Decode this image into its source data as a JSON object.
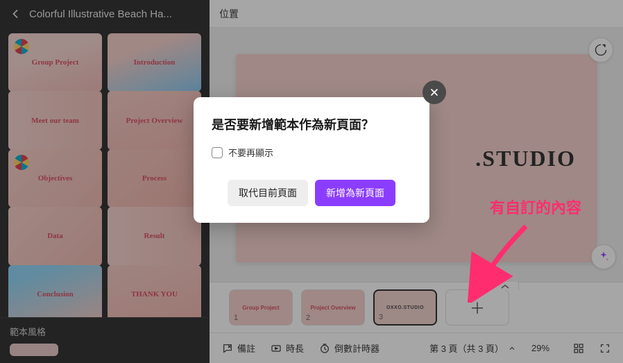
{
  "sidebar": {
    "title": "Colorful Illustrative Beach Ha...",
    "footer_label": "範本風格",
    "templates": [
      {
        "label": "Group Project",
        "cls": "thumb-group"
      },
      {
        "label": "Introduction",
        "cls": "thumb-intro"
      },
      {
        "label": "Meet our team",
        "cls": "thumb-team"
      },
      {
        "label": "Project Overview",
        "cls": "thumb-overview"
      },
      {
        "label": "Objectives",
        "cls": "thumb-obj"
      },
      {
        "label": "Process",
        "cls": "thumb-process"
      },
      {
        "label": "Data",
        "cls": "thumb-data"
      },
      {
        "label": "Result",
        "cls": "thumb-result"
      },
      {
        "label": "Conclusion",
        "cls": "thumb-conclusion"
      },
      {
        "label": "THANK YOU",
        "cls": "thumb-thanks"
      }
    ]
  },
  "top_toolbar": {
    "position_label": "位置"
  },
  "canvas": {
    "text": ".STUDIO"
  },
  "modal": {
    "title": "是否要新增範本作為新頁面？",
    "dont_show_label": "不要再顯示",
    "replace_btn": "取代目前頁面",
    "add_btn": "新增為新頁面"
  },
  "page_strip": {
    "pages": [
      {
        "num": "1",
        "label": "Group Project",
        "cls": ""
      },
      {
        "num": "2",
        "label": "Project Overview",
        "cls": ""
      },
      {
        "num": "3",
        "label": "OXXO.STUDIO",
        "cls": "custom"
      }
    ]
  },
  "bottom_toolbar": {
    "notes": "備註",
    "duration": "時長",
    "timer": "倒數計時器",
    "page_indicator": "第 3 頁（共 3 頁）",
    "zoom": "29%"
  },
  "annotation": {
    "text": "有自訂的內容"
  }
}
